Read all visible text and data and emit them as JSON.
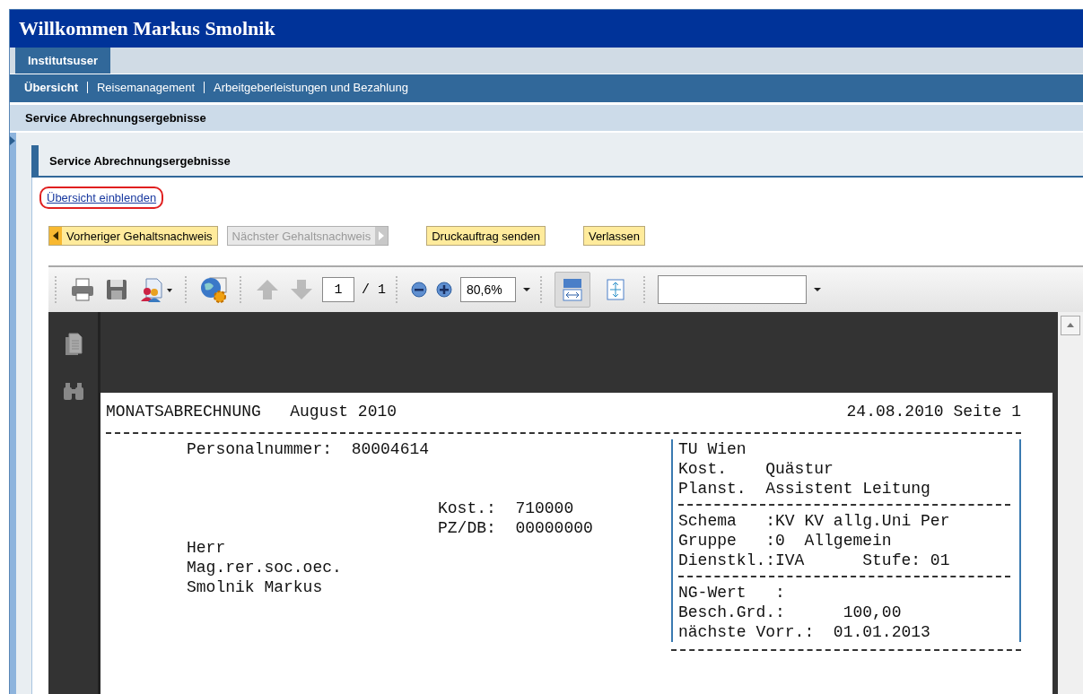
{
  "header": {
    "title": "Willkommen Markus Smolnik"
  },
  "tabs": [
    {
      "label": "Institutsuser",
      "selected": true
    }
  ],
  "nav": [
    {
      "label": "Übersicht",
      "selected": true
    },
    {
      "label": "Reisemanagement",
      "selected": false
    },
    {
      "label": "Arbeitgeberleistungen und Bezahlung",
      "selected": false
    }
  ],
  "page_title": "Service Abrechnungsergebnisse",
  "section_title": "Service Abrechnungsergebnisse",
  "overview_link": {
    "label": "Übersicht einblenden",
    "highlighted": true
  },
  "buttons": [
    {
      "label": "Vorheriger Gehaltsnachweis",
      "kind": "prev",
      "disabled": false
    },
    {
      "label": "Nächster Gehaltsnachweis",
      "kind": "next",
      "disabled": true
    },
    {
      "label": "Druckauftrag senden",
      "kind": "plain",
      "disabled": false
    },
    {
      "label": "Verlassen",
      "kind": "plain",
      "disabled": false
    }
  ],
  "toolbar": {
    "groups": [
      [
        {
          "kind": "print",
          "disabled": false
        },
        {
          "kind": "save",
          "disabled": false
        },
        {
          "kind": "share",
          "disabled": false
        }
      ],
      [
        {
          "kind": "globe",
          "disabled": false
        }
      ],
      [
        {
          "kind": "up",
          "disabled": true
        },
        {
          "kind": "down",
          "disabled": true
        },
        {
          "kind": "page",
          "value": "1",
          "total": "/ 1",
          "disabled": false
        }
      ],
      [
        {
          "kind": "zoom-out",
          "disabled": false
        },
        {
          "kind": "zoom-in",
          "disabled": false
        },
        {
          "kind": "zoom",
          "value": "80,6%",
          "disabled": false
        }
      ],
      [
        {
          "kind": "fit-width",
          "selected": true,
          "disabled": false
        },
        {
          "kind": "fit-page",
          "selected": false,
          "disabled": false
        }
      ],
      [
        {
          "kind": "combo",
          "disabled": false
        }
      ]
    ]
  },
  "document": {
    "title": "MONATSABRECHNUNG   August 2010",
    "date": "24.08.2010 Seite 1",
    "personal_number": "Personalnummer:  80004614",
    "cost_lines": [
      "Kost.:  710000",
      "PZ/DB:  00000000"
    ],
    "address_lines": [
      "Herr",
      "Mag.rer.soc.oec.",
      "Smolnik Markus"
    ],
    "box_sections": [
      [
        "TU Wien",
        "Kost.    Quästur",
        "Planst.  Assistent Leitung"
      ],
      [
        "Schema   :KV KV allg.Uni Per",
        "Gruppe   :0  Allgemein",
        "Dienstkl.:IVA      Stufe: 01"
      ],
      [
        "NG-Wert   :",
        "Besch.Grd.:      100,00",
        "nächste Vorr.:  01.01.2013"
      ]
    ]
  }
}
